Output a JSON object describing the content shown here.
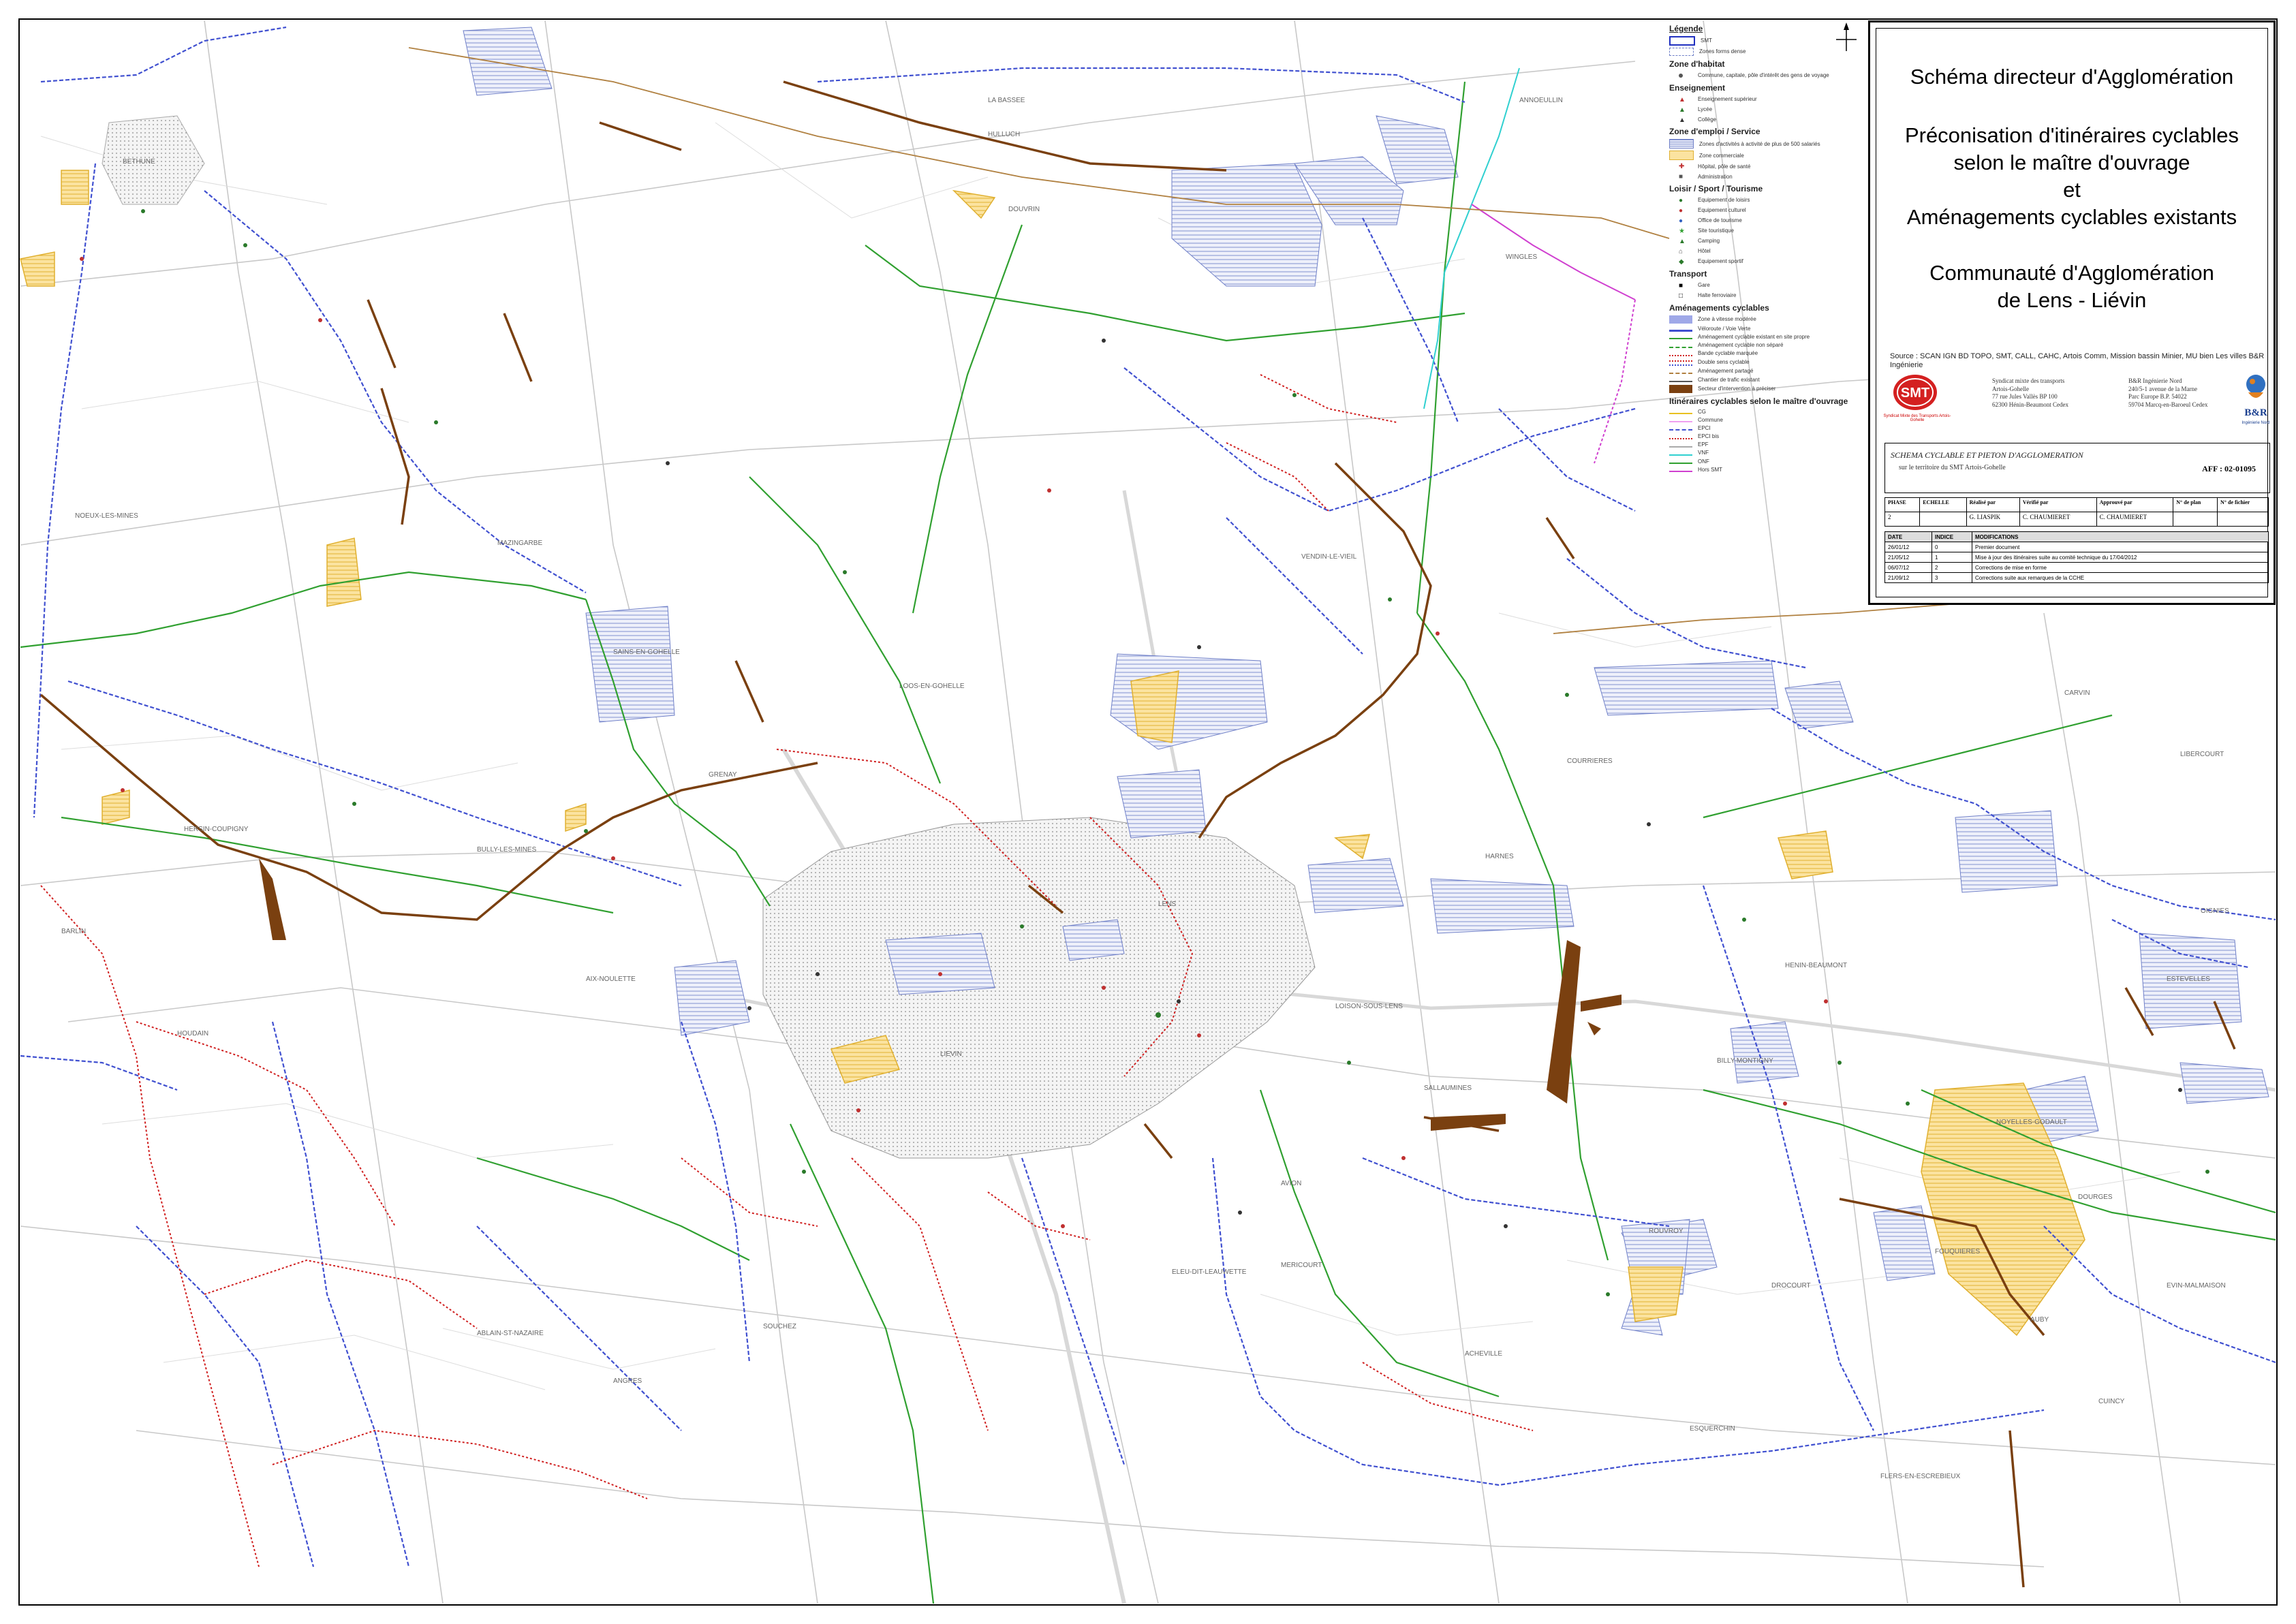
{
  "title_block": {
    "line1": "Schéma directeur d'Agglomération",
    "line2": "Préconisation d'itinéraires cyclables",
    "line3": "selon le maître d'ouvrage",
    "line4": "et",
    "line5": "Aménagements cyclables existants",
    "line6": "Communauté d'Agglomération",
    "line7": "de Lens - Liévin",
    "source": "Source : SCAN IGN BD TOPO, SMT, CALL, CAHC, Artois Comm, Mission bassin Minier, MU bien Les villes B&R Ingénierie",
    "smt_logo_text": "SMT",
    "smt_logo_caption": "Syndicat Mixte des Transports Artois-Gohelle",
    "smt_address": [
      "Syndicat mixte des transports",
      "Artois-Gohelle",
      "77 rue Jules Vallès BP 100",
      "62300 Hénin-Beaumont Cedex"
    ],
    "br_address": [
      "B&R Ingénierie Nord",
      "240/5-1 avenue de la Marne",
      "Parc Europe B.P. 54022",
      "59704 Marcq-en-Baroeul Cedex"
    ],
    "br_logo_text": "B&R",
    "br_logo_sub": "Ingénierie Nord",
    "schema_title": "SCHEMA CYCLABLE ET PIETON D'AGGLOMERATION",
    "schema_sub": "sur le territoire du SMT Artois-Gohelle",
    "aff": "AFF : 02-01095",
    "phase_headers": [
      "PHASE",
      "ECHELLE",
      "Réalisé par",
      "Vérifié par",
      "Approuvé par",
      "N° de plan",
      "N° de fichier"
    ],
    "phase_values": [
      "2",
      "",
      "G. LIASPIK",
      "C. CHAUMIERET",
      "C. CHAUMIERET",
      "",
      ""
    ],
    "mod_headers": [
      "DATE",
      "INDICE",
      "MODIFICATIONS"
    ],
    "mod_rows": [
      [
        "26/01/12",
        "0",
        "Premier document"
      ],
      [
        "21/05/12",
        "1",
        "Mise à jour des itinéraires suite au comité technique du 17/04/2012"
      ],
      [
        "06/07/12",
        "2",
        "Corrections de mise en forme"
      ],
      [
        "21/09/12",
        "3",
        "Corrections suite aux remarques de la CCHE"
      ]
    ]
  },
  "legend": {
    "title": "Légende",
    "limit": "SMT",
    "limit2": "Zones forms dense",
    "s_habitat": "Zone d'habitat",
    "habitat_item": "Commune, capitale, pôle d'intérêt des gens de voyage",
    "s_enseignement": "Enseignement",
    "ens_items": [
      "Enseignement supérieur",
      "Lycée",
      "Collège"
    ],
    "s_emploi": "Zone d'emploi / Service",
    "emploi_items": [
      "Zones d'activités à activité de plus de 500 salariés",
      "Zone commerciale",
      "Hôpital, pôle de santé",
      "Administration"
    ],
    "s_loisir": "Loisir / Sport / Tourisme",
    "loisir_items": [
      "Equipement de loisirs",
      "Equipement culturel",
      "Office de tourisme",
      "Site touristique",
      "Camping",
      "Hôtel",
      "Equipement sportif"
    ],
    "s_transport": "Transport",
    "transport_items": [
      "Gare",
      "Halte ferroviaire"
    ],
    "s_amenag": "Aménagements cyclables",
    "amenag_items": [
      "Zone à vitesse modérée",
      "Véloroute / Voie Verte",
      "Aménagement cyclable existant en site propre",
      "Aménagement cyclable non séparé",
      "Bande cyclable marquée",
      "Double sens cyclable",
      "Aménagement partagé",
      "Chantier de trafic existant",
      "Secteur d'intervention à préciser"
    ],
    "s_itin": "Itinéraires cyclables selon le maître d'ouvrage",
    "itin_items": [
      "CG",
      "Commune",
      "EPCI",
      "EPCI bis",
      "EPF",
      "VNF",
      "ONF",
      "Hors SMT"
    ],
    "colors": {
      "cg": "#e8c020",
      "commune": "#f0a0f0",
      "epci": "#4040d0",
      "epci_bis": "#d02020",
      "green": "#30a030",
      "brown": "#6b3a10",
      "orange": "#e08020",
      "cyan": "#30d0d0",
      "magenta": "#d040d0",
      "yellow_fill": "#f8d070",
      "hatch": "#8090d0"
    }
  },
  "place_labels": [
    "BETHUNE",
    "NOEUX-LES-MINES",
    "BULLY-LES-MINES",
    "LOOS-EN-GOHELLE",
    "GRENAY",
    "LIEVIN",
    "LENS",
    "MAZINGARBE",
    "VENDIN-LE-VIEIL",
    "HULLUCH",
    "WINGLES",
    "HARNES",
    "COURRIERES",
    "HENIN-BEAUMONT",
    "AVION",
    "SALLAUMINES",
    "NOYELLES-GODAULT",
    "CARVIN",
    "ESTEVELLES",
    "ANNOEULLIN",
    "SOUCHEZ",
    "ACHEVILLE",
    "DOUVRIN",
    "LA BASSEE",
    "MERICOURT",
    "BILLY-MONTIGNY",
    "ROUVROY",
    "DROCOURT",
    "ABLAIN-ST-NAZAIRE",
    "ANGRES",
    "ELEU-DIT-LEAUWETTE",
    "HERSIN-COUPIGNY",
    "BARLIN",
    "HOUDAIN",
    "SAINS-EN-GOHELLE",
    "AIX-NOULETTE",
    "FOUQUIERES",
    "OIGNIES",
    "AUBY",
    "DOURGES",
    "EVIN-MALMAISON",
    "LIBERCOURT",
    "CUINCY",
    "ESQUERCHIN",
    "LOISON-SOUS-LENS",
    "FLERS-EN-ESCREBIEUX"
  ]
}
